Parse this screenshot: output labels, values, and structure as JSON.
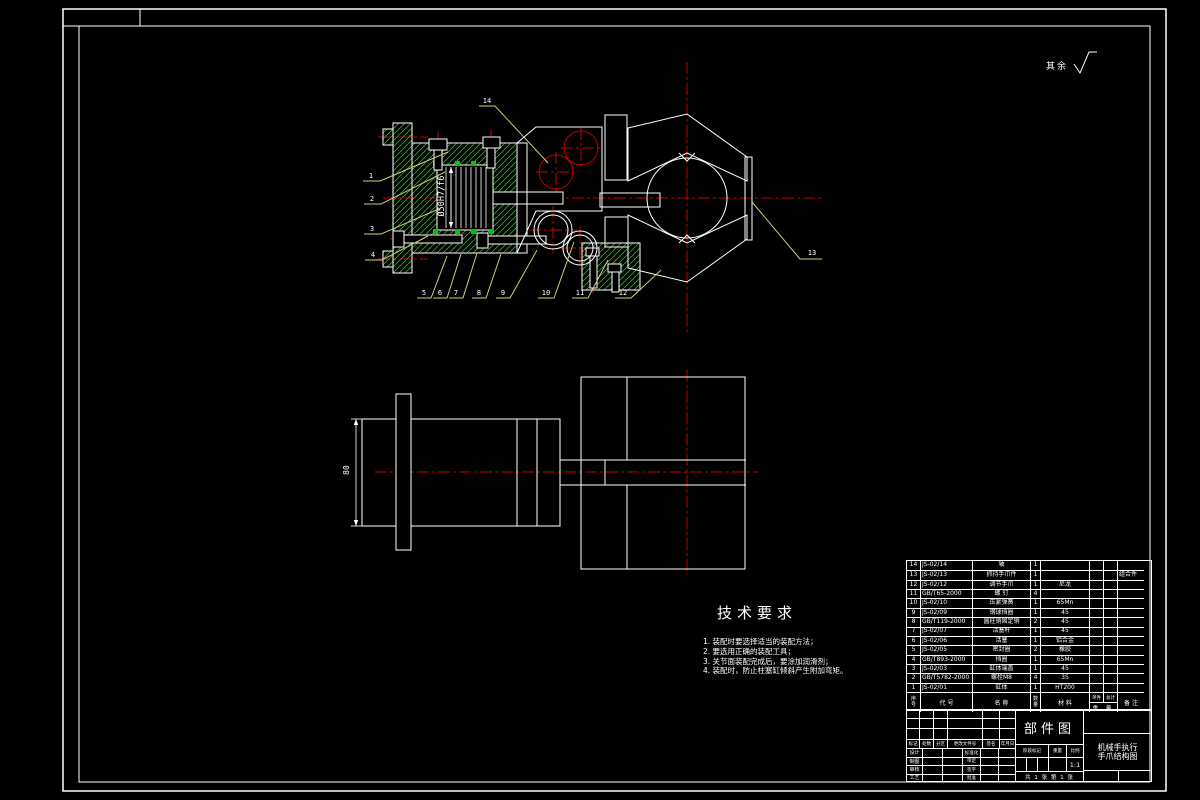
{
  "surface_note": {
    "label": "其余"
  },
  "tech": {
    "title": "技术要求",
    "items": [
      "1. 装配时要选择适当的装配方法；",
      "2. 要选用正确的装配工具；",
      "3. 关节面装配完成后，要涂加润滑剂；",
      "4. 装配时，防止柱塞缸倾斜产生附加弯矩。"
    ]
  },
  "dimensions": {
    "bore": "Ø50H7/f6",
    "height": "80"
  },
  "callouts": [
    "1",
    "2",
    "3",
    "4",
    "5",
    "6",
    "7",
    "8",
    "9",
    "10",
    "11",
    "12",
    "13",
    "14"
  ],
  "bom": {
    "headers": {
      "seq_top": "序",
      "seq_bot": "号",
      "code": "代  号",
      "name": "名    称",
      "qty_top": "数",
      "qty_bot": "量",
      "material": "材  料",
      "unit": "单件",
      "total": "总计",
      "weight": "重 量",
      "remark": "备 注"
    },
    "rows": [
      {
        "seq": "14",
        "code": "JS-02/14",
        "name": "轴",
        "qty": "1",
        "material": "",
        "unit": "",
        "total": "",
        "remark": ""
      },
      {
        "seq": "13",
        "code": "JS-02/13",
        "name": "抓持手爪件",
        "qty": "1",
        "material": "",
        "unit": "",
        "total": "",
        "remark": "组合件"
      },
      {
        "seq": "12",
        "code": "JS-02/12",
        "name": "调节手爪",
        "qty": "1",
        "material": "尼龙",
        "unit": "",
        "total": "",
        "remark": ""
      },
      {
        "seq": "11",
        "code": "GB/T65-2000",
        "name": "螺 钉",
        "qty": "4",
        "material": "",
        "unit": "",
        "total": "",
        "remark": ""
      },
      {
        "seq": "10",
        "code": "JS-02/10",
        "name": "压紧弹簧",
        "qty": "1",
        "material": "65Mn",
        "unit": "",
        "total": "",
        "remark": ""
      },
      {
        "seq": "9",
        "code": "JS-02/09",
        "name": "钢球挡圈",
        "qty": "1",
        "material": "45",
        "unit": "",
        "total": "",
        "remark": ""
      },
      {
        "seq": "8",
        "code": "GB/T119-2000",
        "name": "圆柱销固定销",
        "qty": "2",
        "material": "45",
        "unit": "",
        "total": "",
        "remark": ""
      },
      {
        "seq": "7",
        "code": "JS-02/07",
        "name": "活塞杆",
        "qty": "1",
        "material": "45",
        "unit": "",
        "total": "",
        "remark": ""
      },
      {
        "seq": "6",
        "code": "JS-02/06",
        "name": "活塞",
        "qty": "1",
        "material": "铝合金",
        "unit": "",
        "total": "",
        "remark": ""
      },
      {
        "seq": "5",
        "code": "JS-02/05",
        "name": "密封圈",
        "qty": "2",
        "material": "橡胶",
        "unit": "",
        "total": "",
        "remark": ""
      },
      {
        "seq": "4",
        "code": "GB/T893-2000",
        "name": "挡圈",
        "qty": "1",
        "material": "65Mn",
        "unit": "",
        "total": "",
        "remark": ""
      },
      {
        "seq": "3",
        "code": "JS-02/03",
        "name": "缸体端盖",
        "qty": "1",
        "material": "45",
        "unit": "",
        "total": "",
        "remark": ""
      },
      {
        "seq": "2",
        "code": "GB/T5782-2000",
        "name": "螺栓M8",
        "qty": "4",
        "material": "35",
        "unit": "",
        "total": "",
        "remark": ""
      },
      {
        "seq": "1",
        "code": "JS-02/01",
        "name": "缸体",
        "qty": "1",
        "material": "HT200",
        "unit": "",
        "total": "",
        "remark": ""
      }
    ]
  },
  "title_block": {
    "doc_type": "部件图",
    "product_line1": "机械手执行",
    "product_line2": "手爪结构图",
    "rev_headers": [
      "标记",
      "处数",
      "分区",
      "更改文件号",
      "签名",
      "年月日"
    ],
    "sig_rows": [
      [
        "设计",
        "标准化"
      ],
      [
        "制图",
        "审定"
      ],
      [
        "审核",
        "签字"
      ],
      [
        "工艺",
        "批准"
      ]
    ],
    "stage_label": "阶段标记",
    "weight_label": "重量",
    "scale_label": "比例",
    "scale_value": "1:1",
    "sheet_note": "共 1 张 第 1 张"
  },
  "colors": {
    "hatch": "#00c800",
    "centerline": "#c40000",
    "leader": "#cfcf7a",
    "line": "#ffffff"
  }
}
